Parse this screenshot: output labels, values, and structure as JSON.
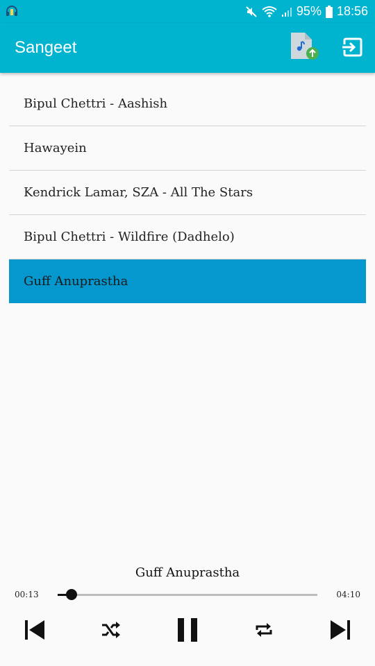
{
  "status_bar": {
    "battery": "95%",
    "time": "18:56"
  },
  "app_bar": {
    "title": "Sangeet",
    "actions": [
      "upload-music-icon",
      "exit-icon"
    ]
  },
  "songs": [
    {
      "title": "Bipul Chettri - Aashish",
      "selected": false
    },
    {
      "title": "Hawayein",
      "selected": false
    },
    {
      "title": "Kendrick Lamar, SZA - All The Stars",
      "selected": false
    },
    {
      "title": "Bipul Chettri - Wildfire (Dadhelo)",
      "selected": false
    },
    {
      "title": "Guff Anuprastha",
      "selected": true
    }
  ],
  "player": {
    "now_playing": "Guff Anuprastha",
    "current_time": "00:13",
    "total_time": "04:10",
    "progress": 0.054,
    "state": "playing",
    "controls": [
      "skip-previous-icon",
      "shuffle-icon",
      "pause-icon",
      "repeat-icon",
      "skip-next-icon"
    ]
  },
  "colors": {
    "primary": "#00b4d0",
    "selected_row": "#0598cf",
    "background": "#fafafa",
    "divider": "#d4d4d4"
  }
}
